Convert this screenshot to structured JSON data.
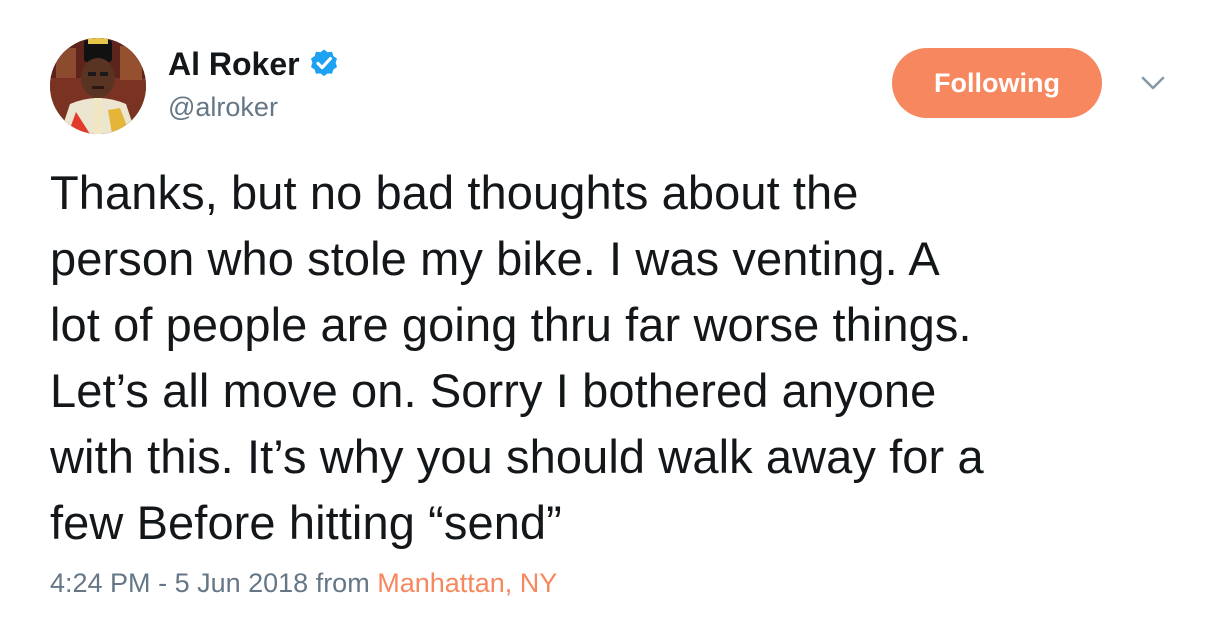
{
  "author": {
    "display_name": "Al Roker",
    "handle": "@alroker",
    "verified": true,
    "avatar_icon": "profile-photo"
  },
  "actions": {
    "follow_label": "Following",
    "more_icon": "chevron-down-icon"
  },
  "tweet": {
    "text": "Thanks, but no bad thoughts about the\nperson who stole my bike. I was venting. A\nlot of people are going thru far worse things.\nLet’s all move on. Sorry I bothered anyone\nwith this. It’s why you should walk away for a\nfew Before hitting “send”"
  },
  "meta": {
    "time": "4:24 PM",
    "separator": " - ",
    "date": "5 Jun 2018",
    "from_label": " from ",
    "location": "Manhattan, NY"
  },
  "colors": {
    "accent": "#f7875e",
    "verified_blue": "#1da1f2",
    "secondary_text": "#657786",
    "primary_text": "#14171a"
  }
}
